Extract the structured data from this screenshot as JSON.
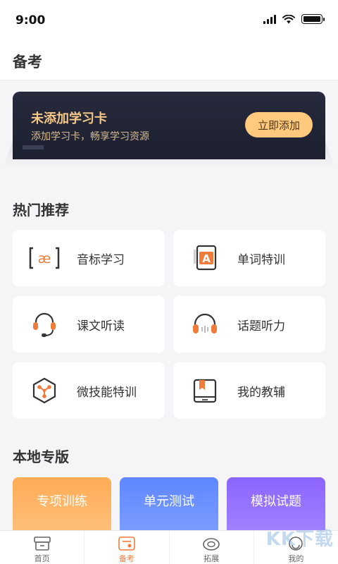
{
  "status_bar": {
    "time": "9:00"
  },
  "header": {
    "title": "备考"
  },
  "study_card": {
    "title": "未添加学习卡",
    "subtitle": "添加学习卡，畅享学习资源",
    "button_label": "立即添加"
  },
  "hot": {
    "title": "热门推荐",
    "items": [
      {
        "label": "音标学习",
        "icon": "phonetic-icon"
      },
      {
        "label": "单词特训",
        "icon": "word-book-icon"
      },
      {
        "label": "课文听读",
        "icon": "headset-mic-icon"
      },
      {
        "label": "话题听力",
        "icon": "headphones-icon"
      },
      {
        "label": "微技能特训",
        "icon": "hexagon-skill-icon"
      },
      {
        "label": "我的教辅",
        "icon": "book-icon"
      }
    ]
  },
  "local": {
    "title": "本地专版",
    "cards": [
      {
        "label": "专项训练",
        "color": "#ffac55"
      },
      {
        "label": "单元测试",
        "color": "#5f86ff"
      },
      {
        "label": "模拟试题",
        "color": "#8b64ff"
      }
    ]
  },
  "tabbar": {
    "tabs": [
      {
        "label": "首页",
        "icon": "home-icon"
      },
      {
        "label": "备考",
        "icon": "exam-prep-icon",
        "active": true
      },
      {
        "label": "拓展",
        "icon": "expand-icon"
      },
      {
        "label": "我的",
        "icon": "profile-icon"
      }
    ]
  },
  "watermark": {
    "text": "KK下载"
  },
  "colors": {
    "accent": "#f07c3b",
    "card_gold": "#ffc97e"
  }
}
